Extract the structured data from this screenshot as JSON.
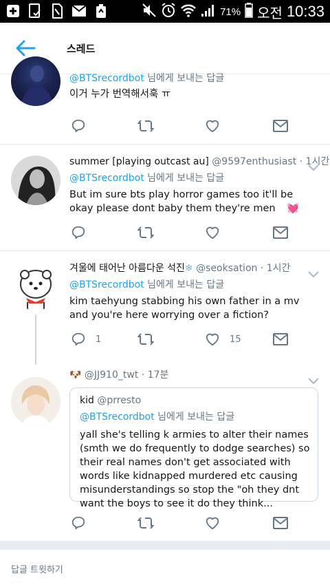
{
  "status_bar": {
    "battery_percent": "71%",
    "ampm": "오전",
    "time": "10:33"
  },
  "header": {
    "title": "스레드"
  },
  "tweets": [
    {
      "reply_prefix": "@BTSrecordbot",
      "reply_suffix": " 님에게 보내는 답글",
      "text": "이거 누가 번역해서훅 ㅠ"
    },
    {
      "name": "summer [playing outcast au]",
      "handle": "@9597enthusiast",
      "time": " · 1시간",
      "reply_prefix": "@BTSrecordbot",
      "reply_suffix": " 님에게 보내는 답글",
      "text": "But im sure bts play horror games too it'll be okay please dont baby them they're men",
      "emoji": "💓"
    },
    {
      "name": "겨울에 태어난 아름다운 석진",
      "handle": "@seoksation",
      "time": " · 1시간",
      "reply_prefix": "@BTSrecordbot",
      "reply_suffix": " 님에게 보내는 답글",
      "text": "kim taehyung stabbing his own father in a mv and you're here worrying over a fiction?",
      "reply_count": "1",
      "like_count": "15"
    },
    {
      "name": "🐶",
      "handle": "@JJ910_twt",
      "time": " · 17분",
      "quote": {
        "name": "kid",
        "handle": "@prresto",
        "reply_prefix": "@BTSrecordbot",
        "reply_suffix": " 님에게 보내는 답글",
        "text": "yall she's telling k armies to alter their names (smth we do frequently to dodge searches) so their real names don't get associated with words like kidnapped murdered etc causing misunderstandings so stop the \"oh they dnt want the boys to see it do they think..."
      }
    }
  ],
  "reply_bar": {
    "label": "답글 트윗하기"
  },
  "colors": {
    "accent": "#1da1f2",
    "secondary": "#657786",
    "like": "#e0245e"
  }
}
